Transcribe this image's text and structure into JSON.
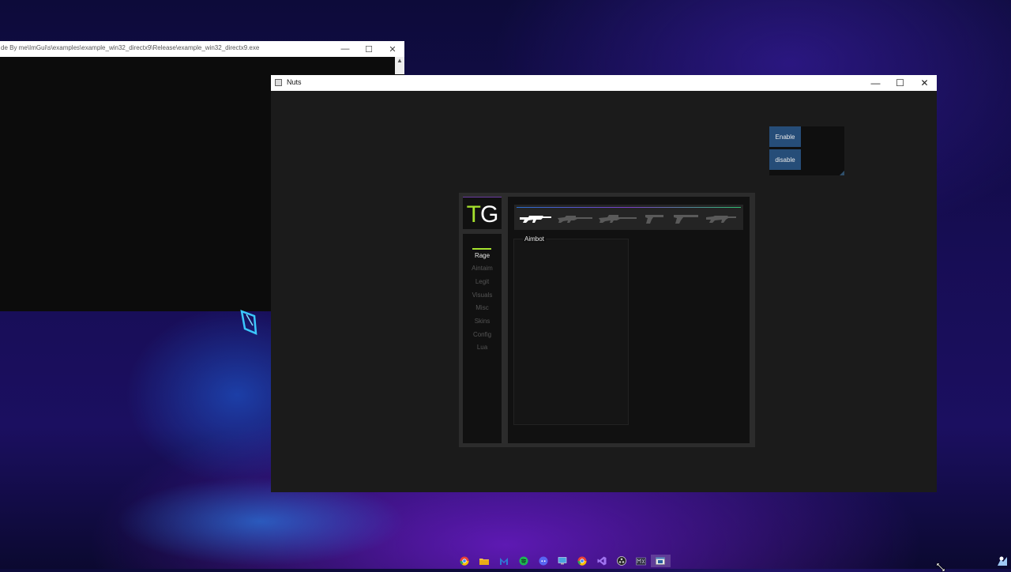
{
  "console_window": {
    "title": "de By me\\ImGui\\s\\examples\\example_win32_directx9\\Release\\example_win32_directx9.exe",
    "scroll_up_arrow": "▲",
    "controls": {
      "minimize": "—",
      "maximize": "☐",
      "close": "✕"
    }
  },
  "main_window": {
    "title": "Nuts",
    "controls": {
      "minimize": "—",
      "maximize": "☐",
      "close": "✕"
    }
  },
  "toggle_panel": {
    "enable_label": "Enable",
    "disable_label": "disable"
  },
  "cheat_menu": {
    "logo": {
      "first": "T",
      "second": "G"
    },
    "nav": [
      {
        "label": "Rage",
        "active": true
      },
      {
        "label": "Aintaim",
        "active": false
      },
      {
        "label": "Legit",
        "active": false
      },
      {
        "label": "Visuals",
        "active": false
      },
      {
        "label": "Misc",
        "active": false
      },
      {
        "label": "Skins",
        "active": false
      },
      {
        "label": "Config",
        "active": false
      },
      {
        "label": "Lua",
        "active": false
      }
    ],
    "weapons": [
      {
        "icon": "assault-rifle-icon",
        "active": true
      },
      {
        "icon": "sniper-rifle-icon",
        "active": false
      },
      {
        "icon": "heavy-sniper-icon",
        "active": false
      },
      {
        "icon": "pistol-icon",
        "active": false
      },
      {
        "icon": "heavy-pistol-icon",
        "active": false
      },
      {
        "icon": "rifle-icon",
        "active": false
      }
    ],
    "group_label": "Aimbot"
  },
  "taskbar": {
    "icons": [
      "chrome-icon",
      "file-explorer-icon",
      "malwarebytes-icon",
      "spotify-icon",
      "discord-icon",
      "remote-desktop-icon",
      "chrome-alt-icon",
      "visual-studio-icon",
      "obs-icon",
      "mixer-icon",
      "app-window-icon"
    ]
  },
  "colors": {
    "accent_green": "#a6e22e",
    "button_blue": "#264d78",
    "menu_bg": "#111111",
    "window_bg": "#1b1b1b"
  }
}
